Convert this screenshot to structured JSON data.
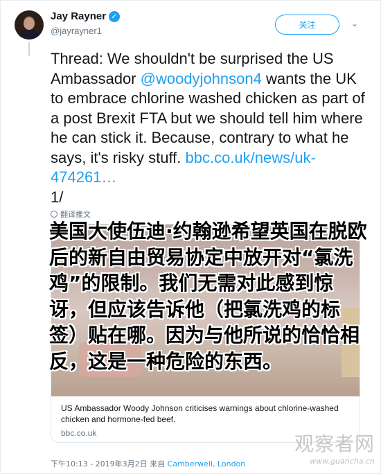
{
  "user": {
    "name": "Jay Rayner",
    "handle": "@jayrayner1",
    "verified_icon": "verified-badge-icon"
  },
  "header": {
    "follow_label": "关注",
    "menu_icon": "chevron-down-icon"
  },
  "tweet": {
    "text_before_mention": "Thread: We shouldn't be surprised the US Ambassador ",
    "mention": "@woodyjohnson4",
    "text_after_mention": " wants the UK to embrace chlorine washed chicken as part of a post Brexit FTA but we should tell him where he can stick it. Because, contrary to what he says, it's risky stuff. ",
    "link": "bbc.co.uk/news/uk-474261…",
    "thread_count": "1/"
  },
  "translate_label": "翻译推文",
  "card": {
    "description": "US Ambassador Woody Johnson criticises warnings about chlorine-washed chicken and hormone-fed beef.",
    "domain": "bbc.co.uk"
  },
  "overlay_translation": "美国大使伍迪·约翰逊希望英国在脱欧后的新自由贸易协定中放开对“氯洗鸡”的限制。我们无需对此感到惊讶，但应该告诉他（把氯洗鸡的标签）贴在哪。因为与他所说的恰恰相反，这是一种危险的东西。",
  "footer": {
    "timestamp": "下午10:13 - 2019年3月2日",
    "from_label": "来自",
    "location": "Camberwell, London"
  },
  "watermark": {
    "main": "观察者网",
    "sub": "www.guancha.cn"
  },
  "colors": {
    "accent": "#1da1f2",
    "text": "#14171a",
    "muted": "#657786"
  }
}
